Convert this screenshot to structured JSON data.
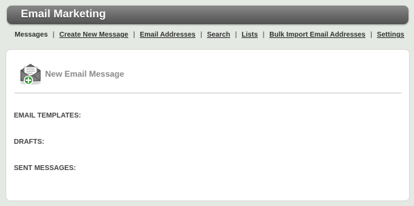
{
  "header": {
    "title": "Email Marketing"
  },
  "nav": {
    "items": [
      {
        "label": "Messages",
        "underlined": false
      },
      {
        "label": "Create New Message",
        "underlined": true
      },
      {
        "label": "Email Addresses",
        "underlined": true
      },
      {
        "label": "Search",
        "underlined": true
      },
      {
        "label": "Lists",
        "underlined": true
      },
      {
        "label": "Bulk Import Email Addresses",
        "underlined": true
      },
      {
        "label": "Settings",
        "underlined": true
      }
    ],
    "separator": "|"
  },
  "main": {
    "new_message": {
      "label": "New Email Message",
      "icon": "envelope-add-icon"
    },
    "sections": [
      {
        "label": "EMAIL TEMPLATES:"
      },
      {
        "label": "DRAFTS:"
      },
      {
        "label": "SENT MESSAGES:"
      }
    ]
  },
  "colors": {
    "background": "#e4e9e3",
    "titlebar": "#6f6f6f",
    "panel": "#ffffff",
    "accent_plus": "#2e9e2e"
  }
}
